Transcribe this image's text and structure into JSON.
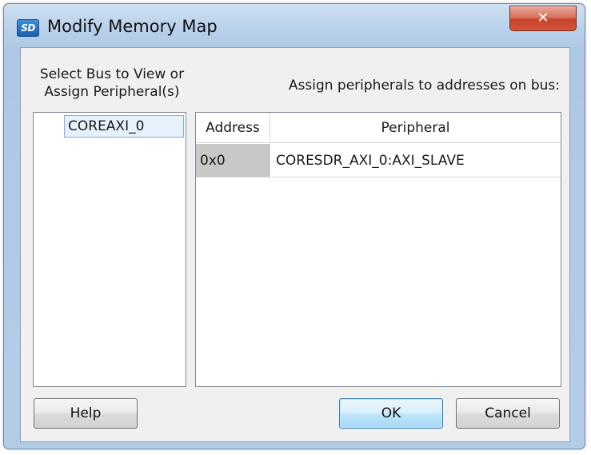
{
  "window": {
    "title": "Modify Memory Map",
    "app_icon_text": "SD",
    "close_glyph": "✕"
  },
  "left_panel": {
    "label": "Select Bus to View or Assign Peripheral(s)",
    "items": [
      {
        "label": "COREAXI_0",
        "selected": true
      }
    ]
  },
  "right_panel": {
    "label": "Assign peripherals to addresses on bus:",
    "columns": [
      "Address",
      "Peripheral"
    ],
    "rows": [
      {
        "address": "0x0",
        "peripheral": "CORESDR_AXI_0:AXI_SLAVE"
      }
    ]
  },
  "buttons": {
    "help": "Help",
    "ok": "OK",
    "cancel": "Cancel"
  },
  "colors": {
    "titlebar": "#b9d1ea",
    "close_button": "#c7432b",
    "client_background": "#f0f0f0",
    "selection": "#e5f1fb",
    "address_cell": "#c8c8c8",
    "ok_button": "#bee6fd"
  }
}
